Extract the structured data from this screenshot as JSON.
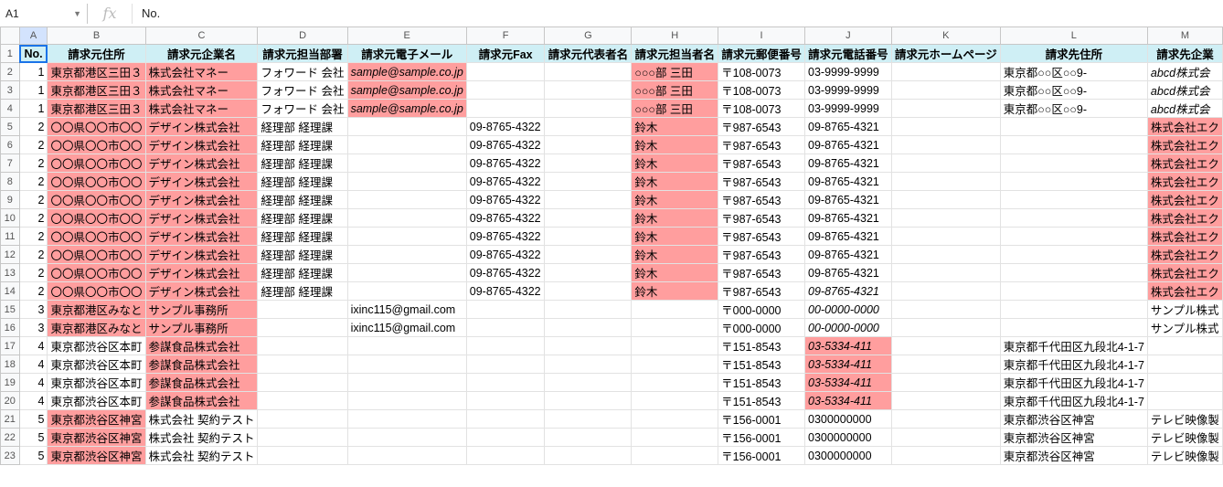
{
  "formula_bar": {
    "cell_ref": "A1",
    "fx_label": "fx",
    "content": "No."
  },
  "columns": [
    "A",
    "B",
    "C",
    "D",
    "E",
    "F",
    "G",
    "H",
    "I",
    "J",
    "K",
    "L",
    "M"
  ],
  "headers": [
    "No.",
    "請求元住所",
    "請求元企業名",
    "請求元担当部署",
    "請求元電子メール",
    "請求元Fax",
    "請求元代表者名",
    "請求元担当者名",
    "請求元郵便番号",
    "請求元電話番号",
    "請求元ホームページ",
    "請求先住所",
    "請求先企業"
  ],
  "rows": [
    {
      "n": "2",
      "cells": [
        "1",
        "東京都港区三田３",
        "株式会社マネー",
        "フォワード 会社",
        "sample@sample.co.jp",
        "",
        "",
        "○○○部 三田",
        "〒108-0073",
        "03-9999-9999",
        "",
        "東京都○○区○○9-",
        "abcd株式会"
      ],
      "pink": [
        1,
        2,
        4,
        7
      ],
      "ital": [
        4,
        12
      ]
    },
    {
      "n": "3",
      "cells": [
        "1",
        "東京都港区三田３",
        "株式会社マネー",
        "フォワード 会社",
        "sample@sample.co.jp",
        "",
        "",
        "○○○部 三田",
        "〒108-0073",
        "03-9999-9999",
        "",
        "東京都○○区○○9-",
        "abcd株式会"
      ],
      "pink": [
        1,
        2,
        4,
        7
      ],
      "ital": [
        4,
        12
      ]
    },
    {
      "n": "4",
      "cells": [
        "1",
        "東京都港区三田３",
        "株式会社マネー",
        "フォワード 会社",
        "sample@sample.co.jp",
        "",
        "",
        "○○○部 三田",
        "〒108-0073",
        "03-9999-9999",
        "",
        "東京都○○区○○9-",
        "abcd株式会"
      ],
      "pink": [
        1,
        2,
        4,
        7
      ],
      "ital": [
        4,
        12
      ]
    },
    {
      "n": "5",
      "cells": [
        "2",
        "〇〇県〇〇市〇〇",
        "デザイン株式会社",
        "経理部 経理課",
        "",
        "09-8765-4322",
        "",
        "鈴木",
        "〒987-6543",
        "09-8765-4321",
        "",
        "",
        "株式会社エク"
      ],
      "pink": [
        1,
        2,
        7,
        12
      ],
      "ital": []
    },
    {
      "n": "6",
      "cells": [
        "2",
        "〇〇県〇〇市〇〇",
        "デザイン株式会社",
        "経理部 経理課",
        "",
        "09-8765-4322",
        "",
        "鈴木",
        "〒987-6543",
        "09-8765-4321",
        "",
        "",
        "株式会社エク"
      ],
      "pink": [
        1,
        2,
        7,
        12
      ],
      "ital": []
    },
    {
      "n": "7",
      "cells": [
        "2",
        "〇〇県〇〇市〇〇",
        "デザイン株式会社",
        "経理部 経理課",
        "",
        "09-8765-4322",
        "",
        "鈴木",
        "〒987-6543",
        "09-8765-4321",
        "",
        "",
        "株式会社エク"
      ],
      "pink": [
        1,
        2,
        7,
        12
      ],
      "ital": []
    },
    {
      "n": "8",
      "cells": [
        "2",
        "〇〇県〇〇市〇〇",
        "デザイン株式会社",
        "経理部 経理課",
        "",
        "09-8765-4322",
        "",
        "鈴木",
        "〒987-6543",
        "09-8765-4321",
        "",
        "",
        "株式会社エク"
      ],
      "pink": [
        1,
        2,
        7,
        12
      ],
      "ital": []
    },
    {
      "n": "9",
      "cells": [
        "2",
        "〇〇県〇〇市〇〇",
        "デザイン株式会社",
        "経理部 経理課",
        "",
        "09-8765-4322",
        "",
        "鈴木",
        "〒987-6543",
        "09-8765-4321",
        "",
        "",
        "株式会社エク"
      ],
      "pink": [
        1,
        2,
        7,
        12
      ],
      "ital": []
    },
    {
      "n": "10",
      "cells": [
        "2",
        "〇〇県〇〇市〇〇",
        "デザイン株式会社",
        "経理部 経理課",
        "",
        "09-8765-4322",
        "",
        "鈴木",
        "〒987-6543",
        "09-8765-4321",
        "",
        "",
        "株式会社エク"
      ],
      "pink": [
        1,
        2,
        7,
        12
      ],
      "ital": []
    },
    {
      "n": "11",
      "cells": [
        "2",
        "〇〇県〇〇市〇〇",
        "デザイン株式会社",
        "経理部 経理課",
        "",
        "09-8765-4322",
        "",
        "鈴木",
        "〒987-6543",
        "09-8765-4321",
        "",
        "",
        "株式会社エク"
      ],
      "pink": [
        1,
        2,
        7,
        12
      ],
      "ital": []
    },
    {
      "n": "12",
      "cells": [
        "2",
        "〇〇県〇〇市〇〇",
        "デザイン株式会社",
        "経理部 経理課",
        "",
        "09-8765-4322",
        "",
        "鈴木",
        "〒987-6543",
        "09-8765-4321",
        "",
        "",
        "株式会社エク"
      ],
      "pink": [
        1,
        2,
        7,
        12
      ],
      "ital": []
    },
    {
      "n": "13",
      "cells": [
        "2",
        "〇〇県〇〇市〇〇",
        "デザイン株式会社",
        "経理部 経理課",
        "",
        "09-8765-4322",
        "",
        "鈴木",
        "〒987-6543",
        "09-8765-4321",
        "",
        "",
        "株式会社エク"
      ],
      "pink": [
        1,
        2,
        7,
        12
      ],
      "ital": []
    },
    {
      "n": "14",
      "cells": [
        "2",
        "〇〇県〇〇市〇〇",
        "デザイン株式会社",
        "経理部 経理課",
        "",
        "09-8765-4322",
        "",
        "鈴木",
        "〒987-6543",
        "09-8765-4321",
        "",
        "",
        "株式会社エク"
      ],
      "pink": [
        1,
        2,
        7,
        12
      ],
      "ital": [
        9
      ]
    },
    {
      "n": "15",
      "cells": [
        "3",
        "東京都港区みなと",
        "サンプル事務所",
        "",
        "ixinc115@gmail.com",
        "",
        "",
        "",
        "〒000-0000",
        "00-0000-0000",
        "",
        "",
        "サンプル株式"
      ],
      "pink": [
        1,
        2
      ],
      "ital": [
        9
      ]
    },
    {
      "n": "16",
      "cells": [
        "3",
        "東京都港区みなと",
        "サンプル事務所",
        "",
        "ixinc115@gmail.com",
        "",
        "",
        "",
        "〒000-0000",
        "00-0000-0000",
        "",
        "",
        "サンプル株式"
      ],
      "pink": [
        1,
        2
      ],
      "ital": [
        9
      ]
    },
    {
      "n": "17",
      "cells": [
        "4",
        "東京都渋谷区本町",
        "参謀食品株式会社",
        "",
        "",
        "",
        "",
        "",
        "〒151-8543",
        "03-5334-411",
        "",
        "東京都千代田区九段北4-1-7",
        ""
      ],
      "pink": [
        2,
        9
      ],
      "ital": [
        9
      ]
    },
    {
      "n": "18",
      "cells": [
        "4",
        "東京都渋谷区本町",
        "参謀食品株式会社",
        "",
        "",
        "",
        "",
        "",
        "〒151-8543",
        "03-5334-411",
        "",
        "東京都千代田区九段北4-1-7",
        ""
      ],
      "pink": [
        2,
        9
      ],
      "ital": [
        9
      ]
    },
    {
      "n": "19",
      "cells": [
        "4",
        "東京都渋谷区本町",
        "参謀食品株式会社",
        "",
        "",
        "",
        "",
        "",
        "〒151-8543",
        "03-5334-411",
        "",
        "東京都千代田区九段北4-1-7",
        ""
      ],
      "pink": [
        2,
        9
      ],
      "ital": [
        9
      ]
    },
    {
      "n": "20",
      "cells": [
        "4",
        "東京都渋谷区本町",
        "参謀食品株式会社",
        "",
        "",
        "",
        "",
        "",
        "〒151-8543",
        "03-5334-411",
        "",
        "東京都千代田区九段北4-1-7",
        ""
      ],
      "pink": [
        2,
        9
      ],
      "ital": [
        9
      ]
    },
    {
      "n": "21",
      "cells": [
        "5",
        "東京都渋谷区神宮",
        "株式会社 契約テスト",
        "",
        "",
        "",
        "",
        "",
        "〒156-0001",
        "0300000000",
        "",
        "東京都渋谷区神宮",
        "テレビ映像製"
      ],
      "pink": [
        1
      ],
      "ital": []
    },
    {
      "n": "22",
      "cells": [
        "5",
        "東京都渋谷区神宮",
        "株式会社 契約テスト",
        "",
        "",
        "",
        "",
        "",
        "〒156-0001",
        "0300000000",
        "",
        "東京都渋谷区神宮",
        "テレビ映像製"
      ],
      "pink": [
        1
      ],
      "ital": []
    },
    {
      "n": "23",
      "cells": [
        "5",
        "東京都渋谷区神宮",
        "株式会社 契約テスト",
        "",
        "",
        "",
        "",
        "",
        "〒156-0001",
        "0300000000",
        "",
        "東京都渋谷区神宮",
        "テレビ映像製"
      ],
      "pink": [
        1
      ],
      "ital": []
    }
  ]
}
